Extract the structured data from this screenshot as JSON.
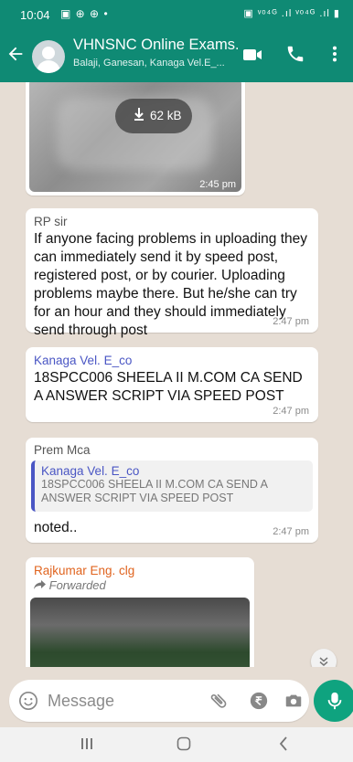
{
  "status_bar": {
    "time": "10:04",
    "left_icons": "▣ ⊕ ⊕ •",
    "right_icons": "▣ ᵛᵒ⁴ᴳ .ıl ᵛᵒ⁴ᴳ .ıl ▮"
  },
  "header": {
    "title": "VHNSNC Online Exams...",
    "members": "Balaji, Ganesan, Kanaga Vel.E_..."
  },
  "messages": [
    {
      "type": "image",
      "download_size": "62 kB",
      "time": "2:45 pm"
    },
    {
      "type": "text",
      "sender": "RP sir",
      "text": "If anyone facing problems in uploading they can immediately send it by speed post, registered post,  or by courier. Uploading problems maybe there. But he/she can try for an hour and they should immediately send through post",
      "time": "2:47 pm"
    },
    {
      "type": "text",
      "sender": "Kanaga Vel. E_co",
      "text": "18SPCC006 SHEELA II M.COM CA SEND A ANSWER SCRIPT VIA SPEED POST",
      "time": "2:47 pm"
    },
    {
      "type": "reply",
      "sender": "Prem Mca",
      "quote_sender": "Kanaga Vel. E_co",
      "quote_text": "18SPCC006 SHEELA II M.COM CA SEND A ANSWER SCRIPT VIA SPEED POST",
      "text": "noted..",
      "time": "2:47 pm"
    },
    {
      "type": "forwarded_image",
      "sender": "Rajkumar Eng. clg",
      "forwarded_label": "Forwarded"
    }
  ],
  "composer": {
    "placeholder": "Message"
  },
  "colors": {
    "header": "#0f8a74",
    "chat_bg": "#e6ddd4",
    "mic": "#0fa37f",
    "sender_kanaga": "#4a56c4",
    "sender_rajkumar": "#e0641f"
  },
  "icons": {
    "back": "back-arrow-icon",
    "video": "video-call-icon",
    "call": "phone-call-icon",
    "menu": "more-vert-icon",
    "emoji": "emoji-icon",
    "attach": "paperclip-icon",
    "payment": "rupee-payment-icon",
    "camera": "camera-icon",
    "mic": "mic-icon",
    "download": "download-arrow-icon",
    "forward": "forward-arrow-icon",
    "scroll": "double-chevron-down-icon"
  }
}
